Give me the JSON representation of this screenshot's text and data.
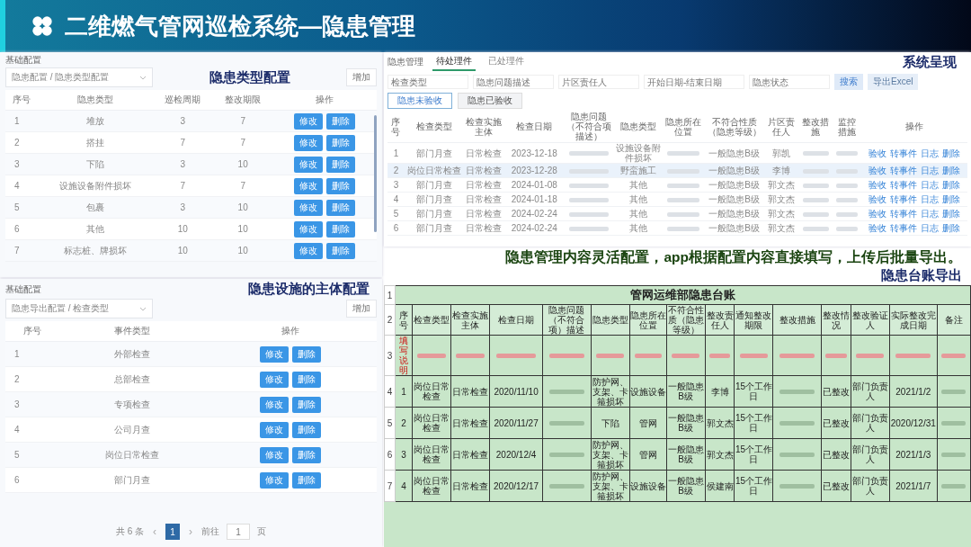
{
  "header": {
    "title": "二维燃气管网巡检系统—隐患管理"
  },
  "type_config": {
    "label": "隐患类型配置",
    "section": "基础配置",
    "breadcrumb": "隐患配置 / 隐患类型配置",
    "add_button": "增加",
    "columns": [
      "序号",
      "隐患类型",
      "巡检周期",
      "整改期限",
      "操作"
    ],
    "rows": [
      {
        "cells": [
          "1",
          "堆放",
          "3",
          "7"
        ],
        "actions": [
          "修改",
          "删除"
        ]
      },
      {
        "cells": [
          "2",
          "搭挂",
          "7",
          "7"
        ],
        "actions": [
          "修改",
          "删除"
        ]
      },
      {
        "cells": [
          "3",
          "下陷",
          "3",
          "10"
        ],
        "actions": [
          "修改",
          "删除"
        ]
      },
      {
        "cells": [
          "4",
          "设施设备附件损坏",
          "7",
          "7"
        ],
        "actions": [
          "修改",
          "删除"
        ]
      },
      {
        "cells": [
          "5",
          "包裹",
          "3",
          "10"
        ],
        "actions": [
          "修改",
          "删除"
        ]
      },
      {
        "cells": [
          "6",
          "其他",
          "10",
          "10"
        ],
        "actions": [
          "修改",
          "删除"
        ]
      },
      {
        "cells": [
          "7",
          "标志桩、牌损坏",
          "10",
          "10"
        ],
        "actions": [
          "修改",
          "删除"
        ]
      }
    ]
  },
  "subject_config": {
    "label": "隐患设施的主体配置",
    "section": "基础配置",
    "breadcrumb": "隐患导出配置 / 检查类型",
    "add_button": "增加",
    "columns": [
      "序号",
      "事件类型",
      "操作"
    ],
    "rows": [
      {
        "cells": [
          "1",
          "外部检查"
        ],
        "actions": [
          "修改",
          "删除"
        ]
      },
      {
        "cells": [
          "2",
          "总部检查"
        ],
        "actions": [
          "修改",
          "删除"
        ]
      },
      {
        "cells": [
          "3",
          "专项检查"
        ],
        "actions": [
          "修改",
          "删除"
        ]
      },
      {
        "cells": [
          "4",
          "公司月查"
        ],
        "actions": [
          "修改",
          "删除"
        ]
      },
      {
        "cells": [
          "5",
          "岗位日常检查"
        ],
        "actions": [
          "修改",
          "删除"
        ]
      },
      {
        "cells": [
          "6",
          "部门月查"
        ],
        "actions": [
          "修改",
          "删除"
        ]
      }
    ],
    "pagination": {
      "total": "共 6 条",
      "prev": "‹",
      "pages": [
        {
          "label": "1",
          "selected": true
        }
      ],
      "next": "›",
      "goto": "前往",
      "page_input": "1",
      "page_unit": "页"
    }
  },
  "system_view": {
    "label": "系统呈现",
    "title": "隐患管理",
    "tabs": [
      {
        "label": "待处理件",
        "selected": true
      },
      {
        "label": "已处理件",
        "selected": false
      }
    ],
    "filters": [
      {
        "placeholder": "检查类型"
      },
      {
        "placeholder": "隐患问题描述"
      },
      {
        "placeholder": "片区责任人"
      },
      {
        "placeholder": "开始日期-结束日期"
      },
      {
        "placeholder": "隐患状态"
      }
    ],
    "search_button": "搜索",
    "export_button": "导出Excel",
    "subtabs": [
      {
        "label": "隐患未验收",
        "selected": true
      },
      {
        "label": "隐患已验收",
        "selected": false
      }
    ],
    "columns": [
      "序号",
      "检查类型",
      "检查实施主体",
      "检查日期",
      "隐患问题（不符合项描述）",
      "隐患类型",
      "隐患所在位置",
      "不符合性质（隐患等级）",
      "片区责任人",
      "整改措施",
      "监控措施",
      "操作"
    ],
    "rows": [
      {
        "cells": [
          "1",
          "部门月查",
          "日常检查",
          "2023-12-18",
          null,
          "设施设备附件损坏",
          null,
          "一般隐患B级",
          "郭凯",
          null,
          null
        ],
        "actions": [
          "验收",
          "转事件",
          "日志",
          "删除"
        ],
        "selected": false
      },
      {
        "cells": [
          "2",
          "岗位日常检查",
          "日常检查",
          "2023-12-28",
          null,
          "野蛮施工",
          null,
          "一般隐患B级",
          "李博",
          null,
          null
        ],
        "actions": [
          "验收",
          "转事件",
          "日志",
          "删除"
        ],
        "selected": true
      },
      {
        "cells": [
          "3",
          "部门月查",
          "日常检查",
          "2024-01-08",
          null,
          "其他",
          null,
          "一般隐患B级",
          "郭文杰",
          null,
          null
        ],
        "actions": [
          "验收",
          "转事件",
          "日志",
          "删除"
        ],
        "selected": false
      },
      {
        "cells": [
          "4",
          "部门月查",
          "日常检查",
          "2024-01-18",
          null,
          "其他",
          null,
          "一般隐患B级",
          "郭文杰",
          null,
          null
        ],
        "actions": [
          "验收",
          "转事件",
          "日志",
          "删除"
        ],
        "selected": false
      },
      {
        "cells": [
          "5",
          "部门月查",
          "日常检查",
          "2024-02-24",
          null,
          "其他",
          null,
          "一般隐患B级",
          "郭文杰",
          null,
          null
        ],
        "actions": [
          "验收",
          "转事件",
          "日志",
          "删除"
        ],
        "selected": false
      },
      {
        "cells": [
          "6",
          "部门月查",
          "日常检查",
          "2024-02-24",
          null,
          "其他",
          null,
          "一般隐患B级",
          "郭文杰",
          null,
          null
        ],
        "actions": [
          "验收",
          "转事件",
          "日志",
          "删除"
        ],
        "selected": false
      }
    ]
  },
  "caption": "隐患管理内容灵活配置，app根据配置内容直接填写，上传后批量导出。",
  "ledger": {
    "label": "隐患台账导出",
    "title": "管网运维部隐患台账",
    "title_row": "1",
    "header_row": "2",
    "columns": [
      "序号",
      "检查类型",
      "检查实施主体",
      "检查日期",
      "隐患问题（不符合项）描述",
      "隐患类型",
      "隐患所在位置",
      "不符合性质（隐患等级）",
      "整改责任人",
      "通知整改期限",
      "整改措施",
      "整改情况",
      "整改验证人",
      "实际整改完成日期",
      "备注"
    ],
    "rows": [
      {
        "row_number": "3",
        "kind": "note",
        "cells": [
          "填写说明",
          null,
          null,
          null,
          null,
          null,
          null,
          null,
          null,
          null,
          null,
          null,
          null,
          null,
          null
        ]
      },
      {
        "row_number": "4",
        "kind": "data",
        "cells": [
          "1",
          "岗位日常检查",
          "日常检查",
          "2020/11/10",
          null,
          "防护网、支架、卡箍损坏",
          "设施设备",
          "一般隐患B级",
          "李博",
          "15个工作日",
          null,
          "已整改",
          "部门负责人",
          "2021/1/2",
          null
        ]
      },
      {
        "row_number": "5",
        "kind": "data",
        "cells": [
          "2",
          "岗位日常检查",
          "日常检查",
          "2020/11/27",
          null,
          "下陷",
          "管网",
          "一般隐患B级",
          "郭文杰",
          "15个工作日",
          null,
          "已整改",
          "部门负责人",
          "2020/12/31",
          null
        ]
      },
      {
        "row_number": "6",
        "kind": "data",
        "cells": [
          "3",
          "岗位日常检查",
          "日常检查",
          "2020/12/4",
          null,
          "防护网、支架、卡箍损坏",
          "管网",
          "一般隐患B级",
          "郭文杰",
          "15个工作日",
          null,
          "已整改",
          "部门负责人",
          "2021/1/3",
          null
        ]
      },
      {
        "row_number": "7",
        "kind": "data",
        "cells": [
          "4",
          "岗位日常检查",
          "日常检查",
          "2020/12/17",
          null,
          "防护网、支架、卡箍损坏",
          "设施设备",
          "一般隐患B级",
          "侯建南",
          "15个工作日",
          null,
          "已整改",
          "部门负责人",
          "2021/1/7",
          null
        ]
      }
    ]
  }
}
